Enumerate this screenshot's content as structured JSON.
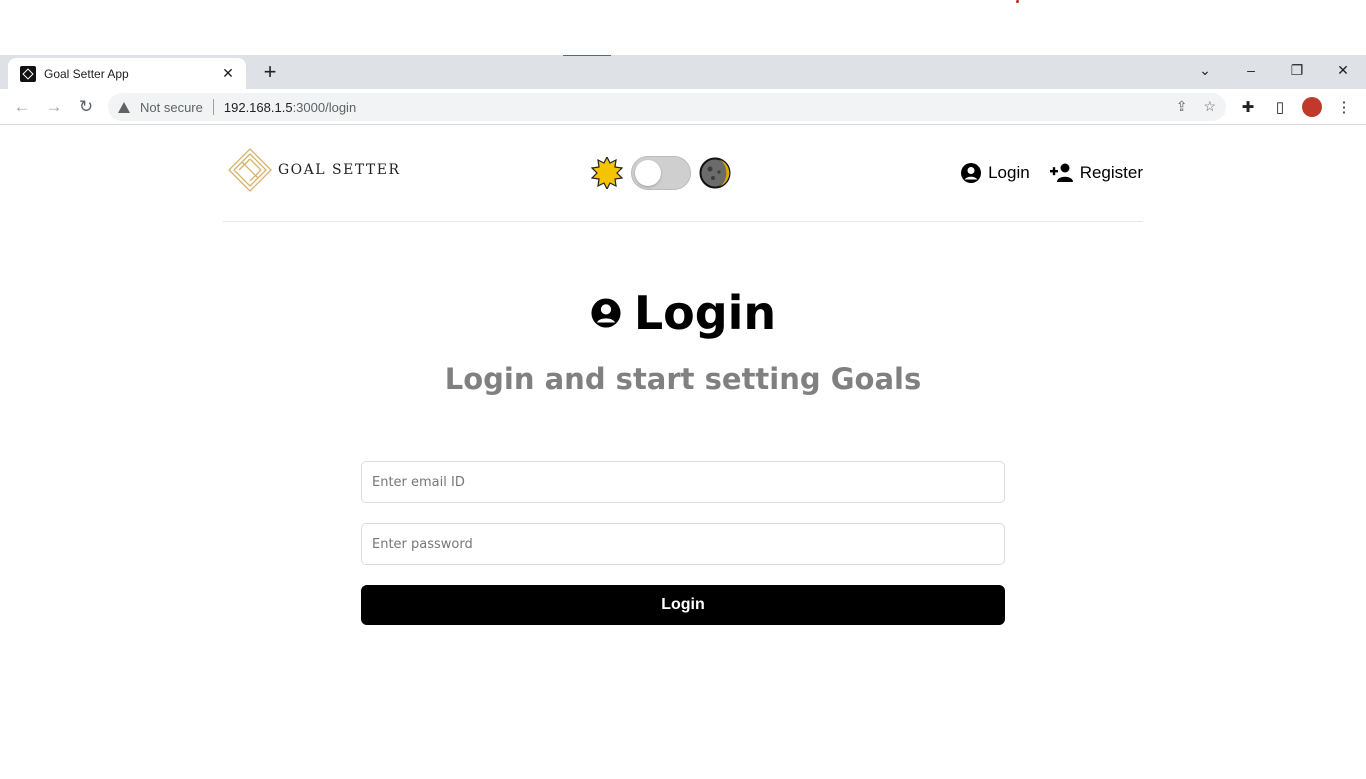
{
  "browser": {
    "tab_title": "Goal Setter App",
    "tab_close": "✕",
    "new_tab": "+",
    "security_label": "Not secure",
    "url_host": "192.168.1.5",
    "url_path": ":3000/login"
  },
  "header": {
    "logo_text": "GOAL SETTER",
    "nav": {
      "login": "Login",
      "register": "Register"
    },
    "theme_toggle_on": false
  },
  "main": {
    "heading": "Login",
    "subheading": "Login and start setting Goals"
  },
  "form": {
    "email_placeholder": "Enter email ID",
    "password_placeholder": "Enter password",
    "submit_label": "Login"
  },
  "colors": {
    "accent": "#000000",
    "logo_gold": "#d4b26a",
    "subheading": "#808080"
  }
}
